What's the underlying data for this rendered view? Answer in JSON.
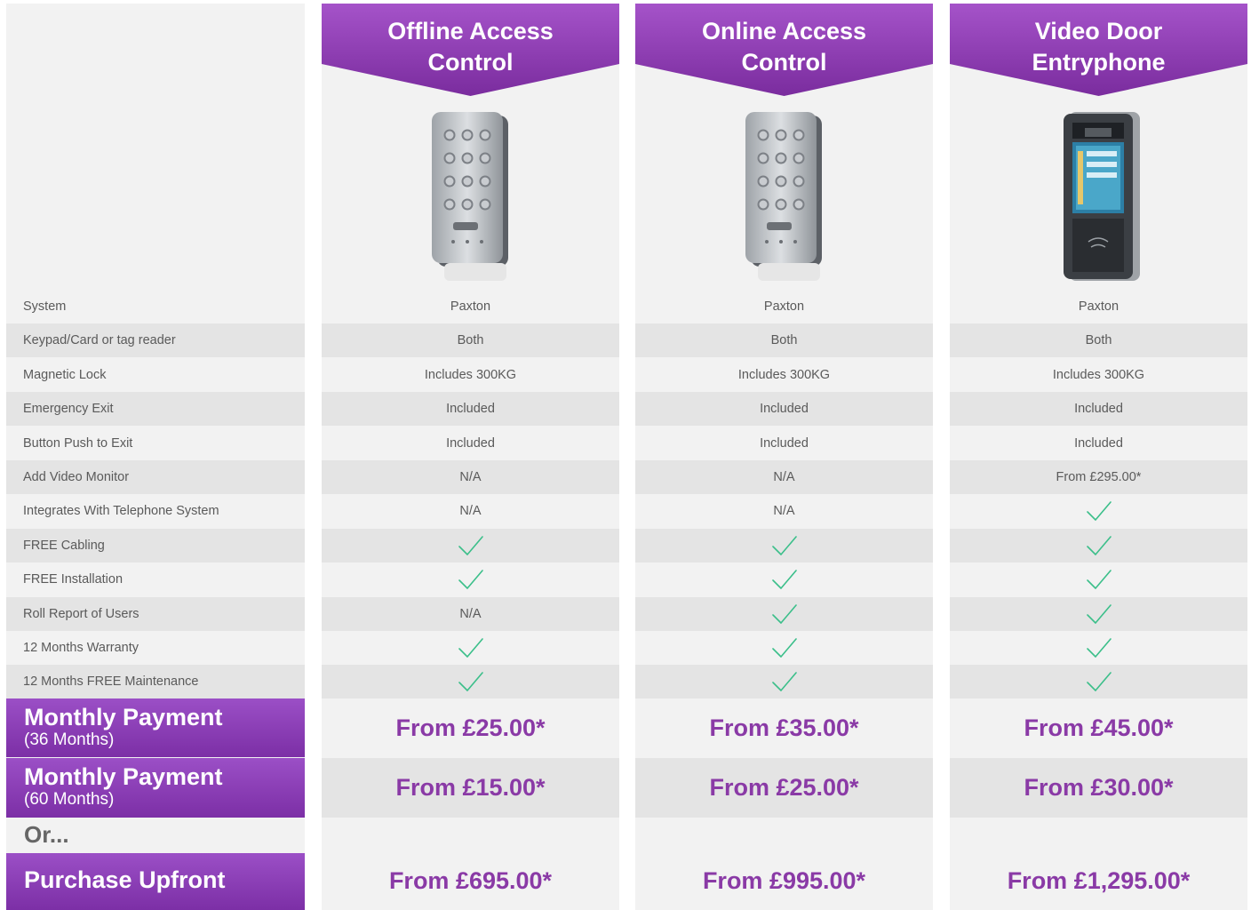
{
  "row_labels": [
    "System",
    "Keypad/Card or tag reader",
    "Magnetic Lock",
    "Emergency Exit",
    "Button Push to Exit",
    "Add Video Monitor",
    "Integrates With Telephone System",
    "FREE Cabling",
    "FREE Installation",
    "Roll Report of Users",
    "12 Months Warranty",
    "12 Months FREE Maintenance"
  ],
  "payment_labels": {
    "monthly_36_main": "Monthly Payment",
    "monthly_36_sub": "(36 Months)",
    "monthly_60_main": "Monthly Payment",
    "monthly_60_sub": "(60 Months)",
    "or": "Or...",
    "upfront": "Purchase Upfront"
  },
  "products": [
    {
      "title": "Offline Access\nControl",
      "image": "keypad-reader",
      "cells": [
        "Paxton",
        "Both",
        "Includes 300KG",
        "Included",
        "Included",
        "N/A",
        "N/A",
        "check",
        "check",
        "N/A",
        "check",
        "check"
      ],
      "monthly_36": "From £25.00*",
      "monthly_60": "From £15.00*",
      "upfront": "From £695.00*"
    },
    {
      "title": "Online Access\nControl",
      "image": "keypad-reader",
      "cells": [
        "Paxton",
        "Both",
        "Includes 300KG",
        "Included",
        "Included",
        "N/A",
        "N/A",
        "check",
        "check",
        "check",
        "check",
        "check"
      ],
      "monthly_36": "From £35.00*",
      "monthly_60": "From £25.00*",
      "upfront": "From £995.00*"
    },
    {
      "title": "Video Door\nEntryphone",
      "image": "video-entry-panel",
      "cells": [
        "Paxton",
        "Both",
        "Includes 300KG",
        "Included",
        "Included",
        "From £295.00*",
        "check",
        "check",
        "check",
        "check",
        "check",
        "check"
      ],
      "monthly_36": "From £45.00*",
      "monthly_60": "From £30.00*",
      "upfront": "From £1,295.00*"
    }
  ],
  "colors": {
    "accent_purple": "#8a3aa6",
    "banner_top": "#a553c9",
    "banner_bottom": "#7a2c9e",
    "check_green": "#3bbf8a",
    "column_bg": "#f2f2f2",
    "alt_row_bg": "#e4e4e4"
  }
}
